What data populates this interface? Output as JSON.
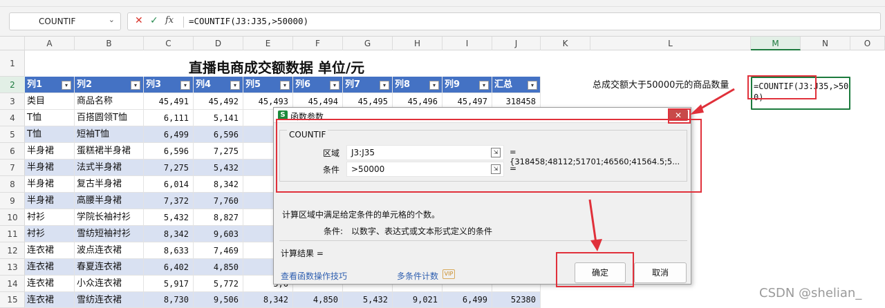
{
  "ribbon_marks": [
    "",
    ""
  ],
  "formula_bar": {
    "name_box": "COUNTIF",
    "cancel_icon": "✕",
    "enter_icon": "✓",
    "fx_label": "fx",
    "formula": "=COUNTIF(J3:J35,>50000)"
  },
  "columns": [
    "A",
    "B",
    "C",
    "D",
    "E",
    "F",
    "G",
    "H",
    "I",
    "J",
    "K",
    "L",
    "M",
    "N",
    "O"
  ],
  "rows": [
    "1",
    "2",
    "3",
    "4",
    "5",
    "6",
    "7",
    "8",
    "9",
    "10",
    "11",
    "12",
    "13",
    "14",
    "15"
  ],
  "sheet": {
    "title": "直播电商成交额数据  单位/元",
    "header": [
      "列1",
      "列2",
      "列3",
      "列4",
      "列5",
      "列6",
      "列7",
      "列8",
      "列9",
      "汇总"
    ],
    "row3": [
      "类目",
      "商品名称",
      "45,491",
      "45,492",
      "45,493",
      "45,494",
      "45,495",
      "45,496",
      "45,497",
      "318458"
    ],
    "rows_ab": [
      [
        "T恤",
        "百搭圆领T恤",
        "6,111",
        "5,141",
        "8,7"
      ],
      [
        "T恤",
        "短袖T恤",
        "6,499",
        "6,596",
        "8,8"
      ],
      [
        "半身裙",
        "蛋糕裙半身裙",
        "6,596",
        "7,275",
        "5,4"
      ],
      [
        "半身裙",
        "法式半身裙",
        "7,275",
        "5,432",
        "4,8"
      ],
      [
        "半身裙",
        "复古半身裙",
        "6,014",
        "8,342",
        "9,6"
      ],
      [
        "半身裙",
        "高腰半身裙",
        "7,372",
        "7,760",
        "7,0"
      ],
      [
        "衬衫",
        "学院长袖衬衫",
        "5,432",
        "8,827",
        "8,6"
      ],
      [
        "衬衫",
        "雪纺短袖衬衫",
        "8,342",
        "9,603",
        "8,4"
      ],
      [
        "连衣裙",
        "波点连衣裙",
        "8,633",
        "7,469",
        "7,2"
      ],
      [
        "连衣裙",
        "春夏连衣裙",
        "6,402",
        "4,850",
        "5,4"
      ],
      [
        "连衣裙",
        "小众连衣裙",
        "5,917",
        "5,772",
        "5,6"
      ]
    ],
    "row15": [
      "连衣裙",
      "雪纺连衣裙",
      "8,730",
      "9,506",
      "8,342",
      "4,850",
      "5,432",
      "9,021",
      "6,499",
      "52380"
    ],
    "label_L2": "总成交额大于50000元的商品数量",
    "cell_M2_line1": "=COUNTIF(J3:J35,>5000",
    "cell_M2_line2": "0)"
  },
  "dialog": {
    "title": "函数参数",
    "icon_letter": "S",
    "close": "✕",
    "function_name": "COUNTIF",
    "range_label": "区域",
    "range_value": "J3:J35",
    "range_result": "= {318458;48112;51701;46560;41564.5;5...",
    "criteria_label": "条件",
    "criteria_value": ">50000",
    "criteria_result": "=",
    "description": "计算区域中满足给定条件的单元格的个数。",
    "criteria_help_label": "条件:",
    "criteria_help": "以数字、表达式或文本形式定义的条件",
    "calc_result": "计算结果 =",
    "help_link": "查看函数操作技巧",
    "multi_link": "多条件计数",
    "vip": "VIP",
    "ok": "确定",
    "cancel": "取消",
    "field_icon": "⇲"
  },
  "watermark": "CSDN @shelian_"
}
